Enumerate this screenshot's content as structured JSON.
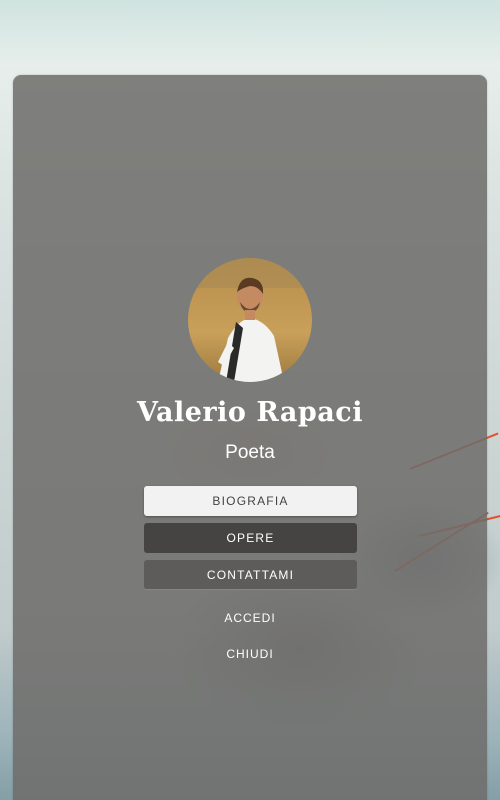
{
  "profile": {
    "name": "Valerio Rapaci",
    "role": "Poeta",
    "avatar_icon": "person-photo"
  },
  "menu": {
    "biography": "BIOGRAFIA",
    "works": "OPERE",
    "contact": "CONTATTAMI"
  },
  "links": {
    "login": "ACCEDI",
    "close": "CHIUDI"
  },
  "colors": {
    "panel": "#6e6c6a",
    "button_light": "#f2f2f2",
    "button_dark": "#454443",
    "button_mid": "#5e5c5a",
    "accent_line": "#e0532c"
  }
}
